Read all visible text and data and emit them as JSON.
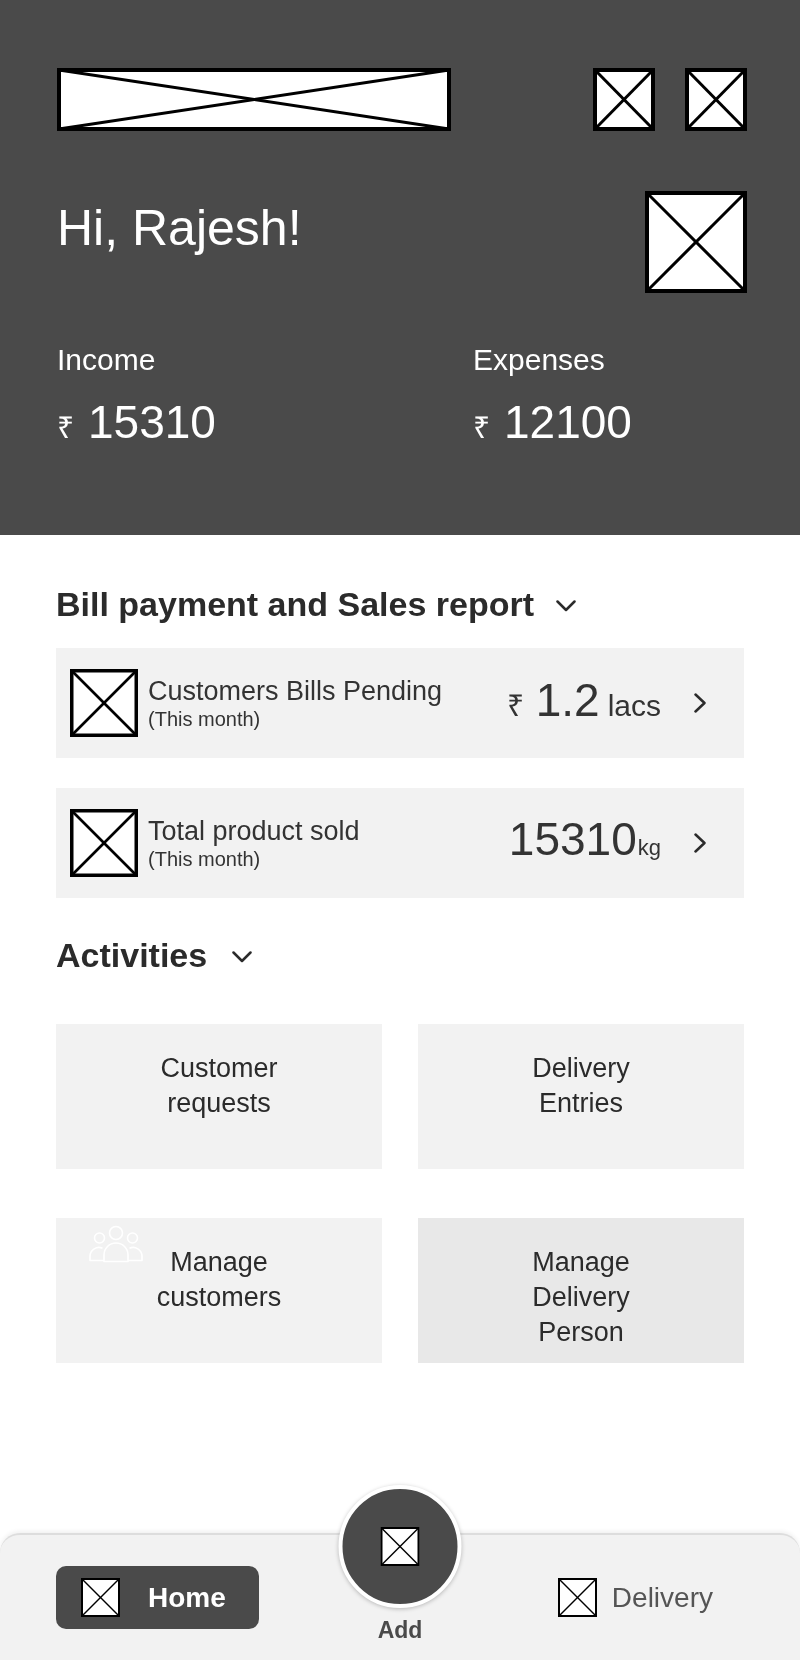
{
  "header": {
    "greeting": "Hi, Rajesh!",
    "stats": [
      {
        "label": "Income",
        "currency": "₹",
        "amount": "15310"
      },
      {
        "label": "Expenses",
        "currency": "₹",
        "amount": "12100"
      }
    ]
  },
  "bill_section": {
    "title": "Bill payment and Sales report",
    "cards": [
      {
        "kind": "amount",
        "title": "Customers Bills Pending",
        "subtitle": "(This month)",
        "currency": "₹",
        "value": "1.2",
        "unit": "lacs"
      },
      {
        "kind": "quantity",
        "title": "Total product sold",
        "subtitle": "(This month)",
        "value": "15310",
        "unit": "kg"
      }
    ]
  },
  "activities": {
    "title": "Activities",
    "tiles": [
      {
        "kind": "plain",
        "label": "Customer requests",
        "color": "#f2f2f2"
      },
      {
        "kind": "plain",
        "label": "Delivery Entries",
        "color": "#f2f2f2"
      },
      {
        "kind": "icon",
        "label": "Manage customers",
        "color": "#f2f2f2"
      },
      {
        "kind": "plain",
        "label": "Manage Delivery Person",
        "color": "#e8e8e8"
      }
    ]
  },
  "bottom_nav": {
    "items": [
      {
        "label": "Home",
        "selected": true
      },
      {
        "label": "Delivery",
        "selected": false
      }
    ],
    "fab": {
      "label": "Add"
    }
  }
}
